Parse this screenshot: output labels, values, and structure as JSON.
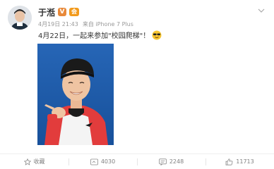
{
  "post": {
    "author": {
      "name": "于湉",
      "verified_badge": "V",
      "vip_badge": "会"
    },
    "meta": {
      "date": "4月19日 21:43",
      "source": "来自 iPhone 7 Plus"
    },
    "text": "4月22日，一起来参加\"校园爬梯\"！",
    "emoji_icon": "sunglasses-emoji-icon",
    "actions": {
      "favorite_label": "收藏",
      "repost_count": "4030",
      "comment_count": "2248",
      "like_count": "11713"
    }
  },
  "colors": {
    "accent_orange": "#e8893a",
    "text_main": "#333333",
    "text_meta": "#999999",
    "photo_bg": "#1c5aa8"
  }
}
